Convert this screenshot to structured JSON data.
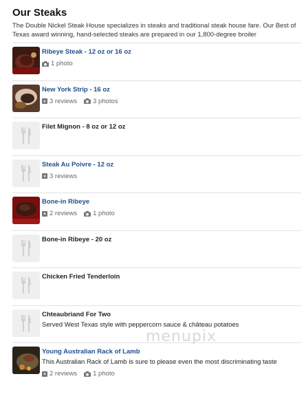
{
  "section": {
    "title": "Our Steaks",
    "intro": "The Double Nickel Steak House specializes in steaks and traditional steak house fare. Our Best of Texas award winning, hand-selected steaks are prepared in our 1,800-degree broiler"
  },
  "items": [
    {
      "name": "Ribeye Steak - 12 oz or 16 oz",
      "linked": true,
      "thumb": "photo",
      "photos": "1 photo"
    },
    {
      "name": "New York Strip - 16 oz",
      "linked": true,
      "thumb": "photo",
      "reviews": "3 reviews",
      "photos": "3 photos"
    },
    {
      "name": "Filet Mignon - 8 oz or 12 oz",
      "linked": false,
      "thumb": "placeholder"
    },
    {
      "name": "Steak Au Poivre - 12 oz",
      "linked": true,
      "thumb": "placeholder",
      "reviews": "3 reviews"
    },
    {
      "name": "Bone-in Ribeye",
      "linked": true,
      "thumb": "photo",
      "reviews": "2 reviews",
      "photos": "1 photo"
    },
    {
      "name": "Bone-in Ribeye - 20 oz",
      "linked": false,
      "thumb": "placeholder"
    },
    {
      "name": "Chicken Fried Tenderloin",
      "linked": false,
      "thumb": "placeholder"
    },
    {
      "name": "Chteaubriand For Two",
      "linked": false,
      "thumb": "placeholder",
      "description": "Served West Texas style with peppercorn sauce & château potatoes"
    },
    {
      "name": "Young Australian Rack of Lamb",
      "linked": true,
      "thumb": "photo",
      "description": "This Australian Rack of Lamb is sure to please even the most discriminating taste",
      "reviews": "2 reviews",
      "photos": "1 photo"
    }
  ],
  "watermark": "menupix",
  "colors": {
    "link": "#1f4f8f",
    "placeholder_bg": "#efefef",
    "divider": "#e2e2e2"
  }
}
